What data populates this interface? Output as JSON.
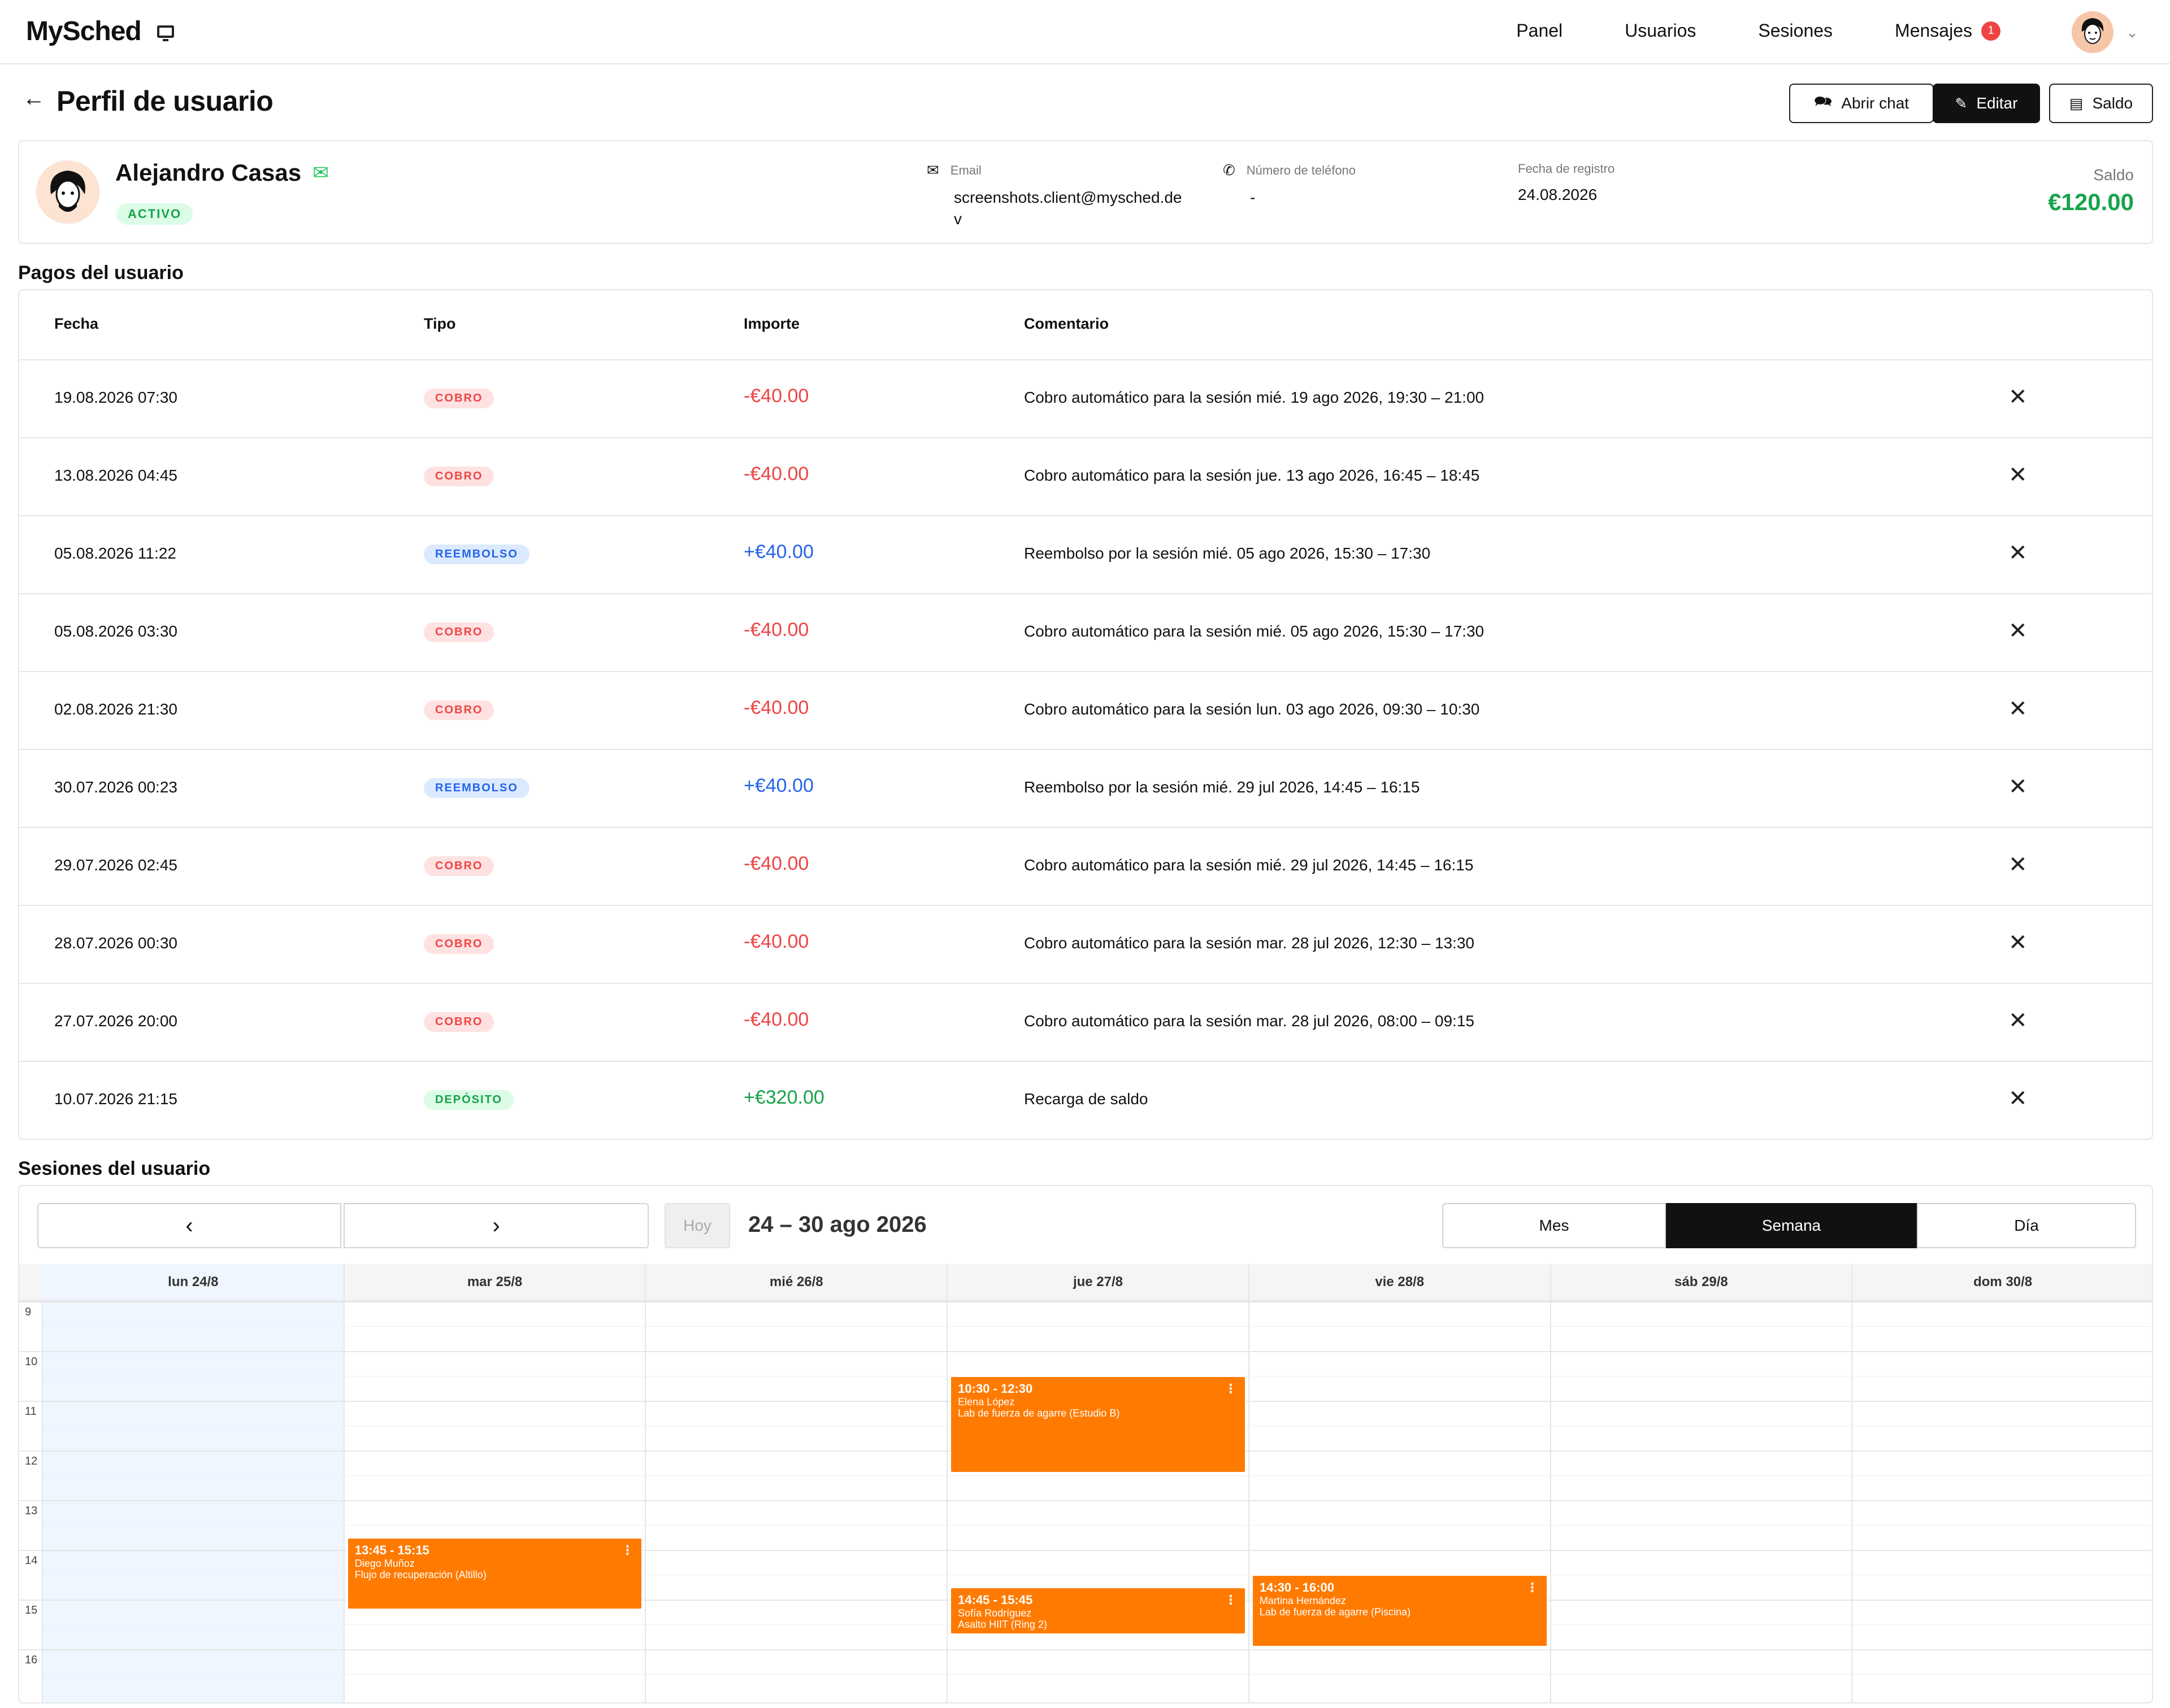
{
  "nav": {
    "brand": "MySched",
    "links": [
      "Panel",
      "Usuarios",
      "Sesiones"
    ],
    "messages_label": "Mensajes",
    "messages_count": "1"
  },
  "header": {
    "back_icon": "arrow-left-icon",
    "title": "Perfil de usuario",
    "buttons": {
      "chat": "Abrir chat",
      "edit": "Editar",
      "balance": "Saldo"
    }
  },
  "profile": {
    "name": "Alejandro Casas",
    "status": "ACTIVO",
    "email_label": "Email",
    "email": "screenshots.client@mysched.de",
    "email_wrap": "v",
    "phone_label": "Número de teléfono",
    "phone": "-",
    "registered_label": "Fecha de registro",
    "registered": "24.08.2026",
    "balance_label": "Saldo",
    "balance": "€120.00"
  },
  "payments": {
    "title": "Pagos del usuario",
    "columns": [
      "Fecha",
      "Tipo",
      "Importe",
      "Comentario"
    ],
    "rows": [
      {
        "fecha": "19.08.2026 07:30",
        "tipo": "COBRO",
        "importe": "-€40.00",
        "comentario": "Cobro automático para la sesión mié. 19 ago 2026, 19:30 – 21:00"
      },
      {
        "fecha": "13.08.2026 04:45",
        "tipo": "COBRO",
        "importe": "-€40.00",
        "comentario": "Cobro automático para la sesión jue. 13 ago 2026, 16:45 – 18:45"
      },
      {
        "fecha": "05.08.2026 11:22",
        "tipo": "REEMBOLSO",
        "importe": "+€40.00",
        "comentario": "Reembolso por la sesión mié. 05 ago 2026, 15:30 – 17:30"
      },
      {
        "fecha": "05.08.2026 03:30",
        "tipo": "COBRO",
        "importe": "-€40.00",
        "comentario": "Cobro automático para la sesión mié. 05 ago 2026, 15:30 – 17:30"
      },
      {
        "fecha": "02.08.2026 21:30",
        "tipo": "COBRO",
        "importe": "-€40.00",
        "comentario": "Cobro automático para la sesión lun. 03 ago 2026, 09:30 – 10:30"
      },
      {
        "fecha": "30.07.2026 00:23",
        "tipo": "REEMBOLSO",
        "importe": "+€40.00",
        "comentario": "Reembolso por la sesión mié. 29 jul 2026, 14:45 – 16:15"
      },
      {
        "fecha": "29.07.2026 02:45",
        "tipo": "COBRO",
        "importe": "-€40.00",
        "comentario": "Cobro automático para la sesión mié. 29 jul 2026, 14:45 – 16:15"
      },
      {
        "fecha": "28.07.2026 00:30",
        "tipo": "COBRO",
        "importe": "-€40.00",
        "comentario": "Cobro automático para la sesión mar. 28 jul 2026, 12:30 – 13:30"
      },
      {
        "fecha": "27.07.2026 20:00",
        "tipo": "COBRO",
        "importe": "-€40.00",
        "comentario": "Cobro automático para la sesión mar. 28 jul 2026, 08:00 – 09:15"
      },
      {
        "fecha": "10.07.2026 21:15",
        "tipo": "DEPÓSITO",
        "importe": "+€320.00",
        "comentario": "Recarga de saldo"
      }
    ]
  },
  "sessions": {
    "title": "Sesiones del usuario",
    "prev_icon": "chevron-left-icon",
    "next_icon": "chevron-right-icon",
    "today": "Hoy",
    "range": "24 – 30 ago 2026",
    "views": [
      "Mes",
      "Semana",
      "Día"
    ],
    "active_view": "Semana",
    "days": [
      "lun 24/8",
      "mar 25/8",
      "mié 26/8",
      "jue 27/8",
      "vie 28/8",
      "sáb 29/8",
      "dom 30/8"
    ],
    "hours": [
      "9",
      "10",
      "11",
      "12",
      "13",
      "14",
      "15",
      "16"
    ],
    "events": [
      {
        "day": 3,
        "start": 10.5,
        "end": 12.5,
        "time": "10:30 - 12:30",
        "person": "Elena López",
        "activity": "Lab de fuerza de agarre (Estudio B)"
      },
      {
        "day": 1,
        "start": 13.75,
        "end": 15.25,
        "time": "13:45 - 15:15",
        "person": "Diego Muñoz",
        "activity": "Flujo de recuperación (Altillo)"
      },
      {
        "day": 3,
        "start": 14.75,
        "end": 15.75,
        "time": "14:45 - 15:45",
        "person": "Sofía Rodríguez",
        "activity": "Asalto HIIT (Ring 2)"
      },
      {
        "day": 4,
        "start": 14.5,
        "end": 16.0,
        "time": "14:30 - 16:00",
        "person": "Martina Hernández",
        "activity": "Lab de fuerza de agarre (Piscina)"
      }
    ]
  },
  "colors": {
    "event": "#ff7a00",
    "positive": "#16a34a",
    "negative": "#ef4444",
    "refund": "#2563eb"
  }
}
